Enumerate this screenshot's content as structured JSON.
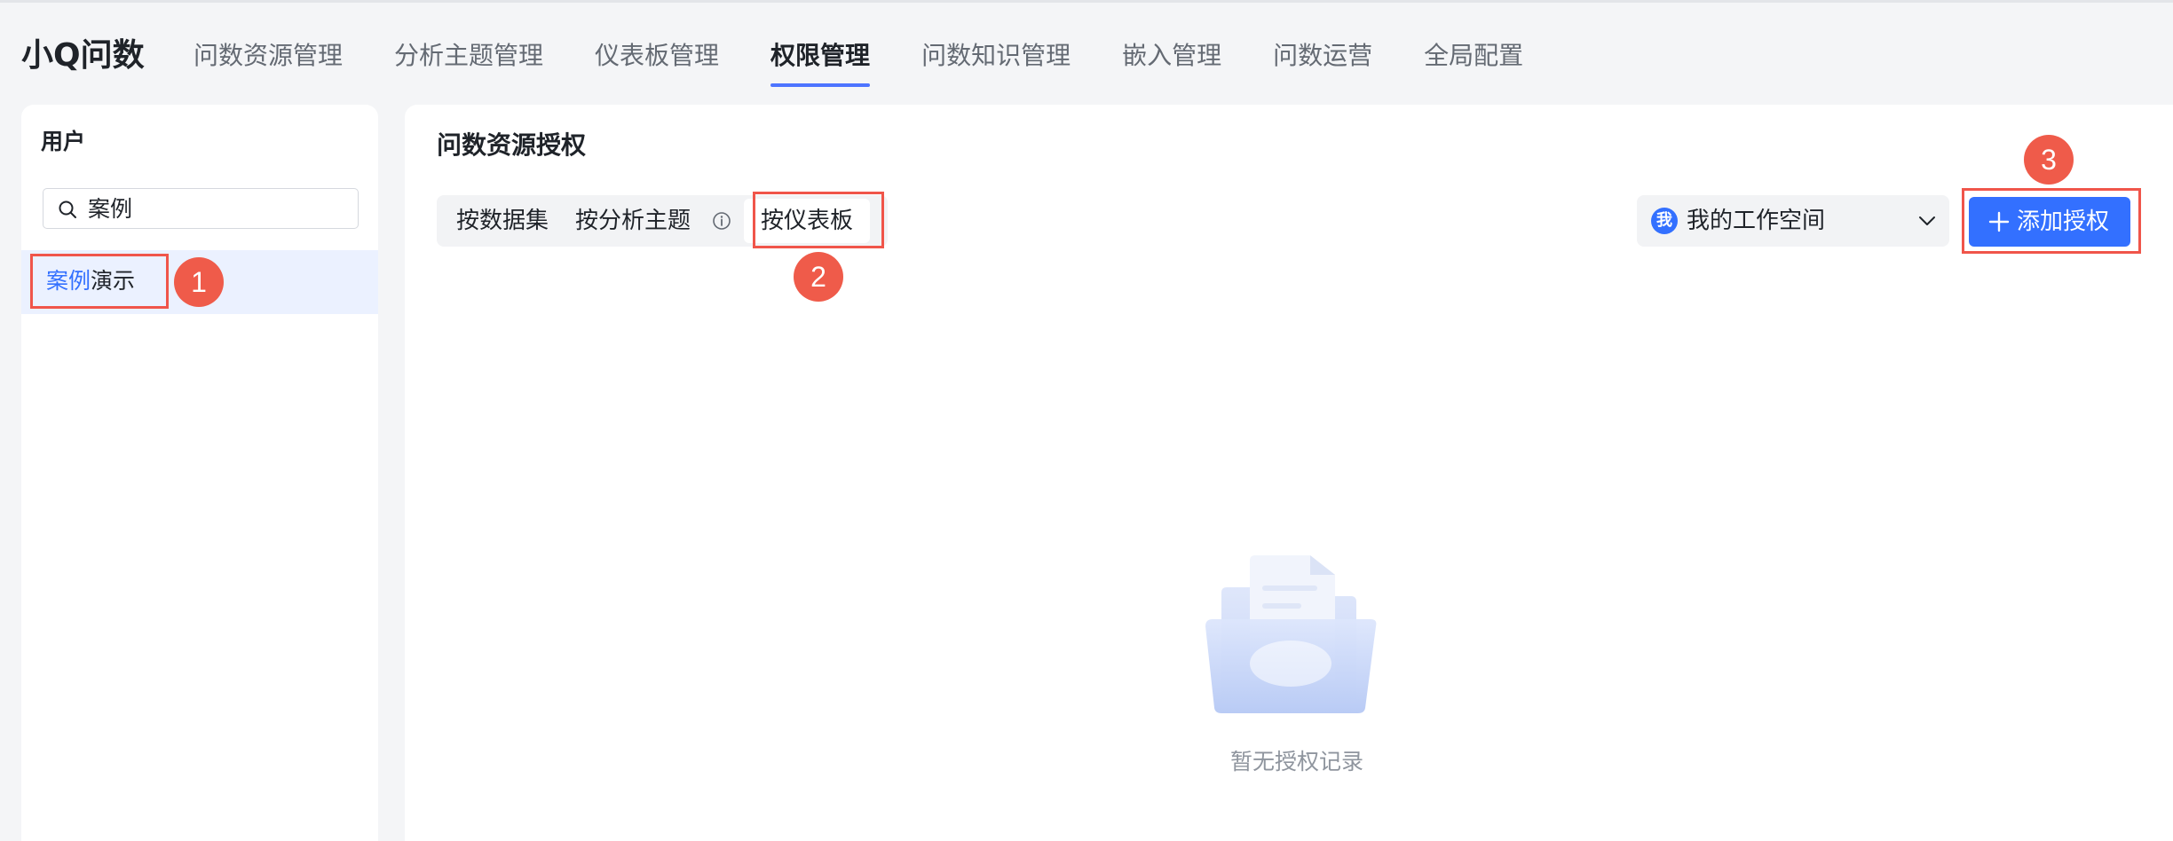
{
  "app": {
    "title": "小Q问数"
  },
  "nav": {
    "items": [
      {
        "label": "问数资源管理"
      },
      {
        "label": "分析主题管理"
      },
      {
        "label": "仪表板管理"
      },
      {
        "label": "权限管理",
        "active": true
      },
      {
        "label": "问数知识管理"
      },
      {
        "label": "嵌入管理"
      },
      {
        "label": "问数运营"
      },
      {
        "label": "全局配置"
      }
    ]
  },
  "sidebar": {
    "title": "用户",
    "search": {
      "value": "案例",
      "icon": "search-icon"
    },
    "users": [
      {
        "label_highlight": "案例",
        "label_rest": "演示",
        "selected": true
      }
    ]
  },
  "main": {
    "title": "问数资源授权",
    "tabs": [
      {
        "label": "按数据集"
      },
      {
        "label": "按分析主题",
        "icon": "info-icon"
      },
      {
        "label": "按仪表板",
        "active": true
      }
    ],
    "workspace": {
      "avatar": "我",
      "label": "我的工作空间",
      "icon": "chevron-down-icon"
    },
    "add_button": {
      "label": "添加授权",
      "icon": "plus-icon"
    },
    "empty": {
      "text": "暂无授权记录",
      "icon": "empty-folder-icon"
    }
  },
  "annotations": [
    {
      "number": "1"
    },
    {
      "number": "2"
    },
    {
      "number": "3"
    }
  ],
  "colors": {
    "accent": "#3370ff",
    "active_underline": "#4d74ff",
    "annotation": "#f0554a",
    "selected_row": "#ebf1ff",
    "page_background": "#f4f5f7"
  }
}
